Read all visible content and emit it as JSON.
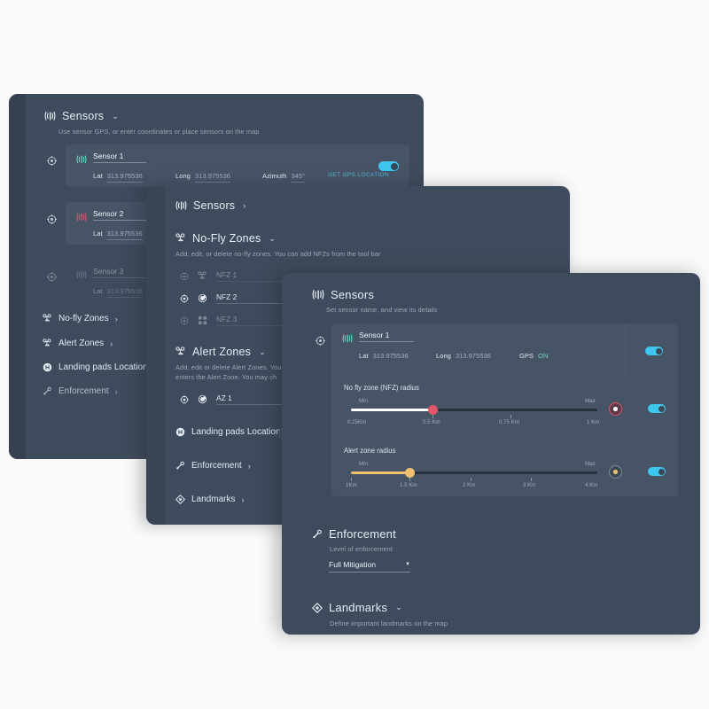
{
  "canvas": {
    "background": "#fafafa"
  },
  "theme": {
    "panel_bg": "#3e4b5c",
    "card_bg": "#475466",
    "accent_cyan": "#3fc6ef",
    "accent_red": "#e05569",
    "accent_amber": "#f0c070",
    "text_primary": "#e8edf2",
    "text_muted": "#9aa7b5"
  },
  "panel_back": {
    "title": "Sensors",
    "chevron": "⌄",
    "subtitle": "Use sensor GPS, or enter coordinates or place sensors on the map",
    "sensors": [
      {
        "name": "Sensor 1",
        "lat_label": "Lat",
        "lat_value": "313.975536",
        "long_label": "Long",
        "long_value": "313.975536",
        "azimuth_label": "Azimuth",
        "azimuth_value": "345°",
        "gps_button": "GET GPS LOCATION",
        "enabled": true,
        "icon": "antenna-icon",
        "icon_color": "#5fe0c0",
        "state": "active"
      },
      {
        "name": "Sensor 2",
        "lat_label": "Lat",
        "lat_value": "313.975536",
        "icon": "antenna-icon",
        "icon_color": "#e05569",
        "state": "selected"
      },
      {
        "name": "Sensor 3",
        "lat_label": "Lat",
        "lat_value": "313.975536",
        "icon": "antenna-icon",
        "icon_color": "#8d9aa8",
        "state": "disabled"
      }
    ],
    "nav": [
      {
        "label": "No-fly Zones",
        "icon": "drone-zone-icon",
        "arrow": "›"
      },
      {
        "label": "Alert Zones",
        "icon": "drone-zone-icon",
        "arrow": "›"
      },
      {
        "label": "Landing pads Location",
        "icon": "helipad-icon",
        "arrow": "›"
      },
      {
        "label": "Enforcement",
        "icon": "enforcement-icon",
        "arrow": "›"
      }
    ]
  },
  "panel_mid": {
    "sensors_link": {
      "label": "Sensors",
      "arrow": "›",
      "icon": "antenna-icon"
    },
    "nfz": {
      "title": "No-Fly Zones",
      "chevron": "⌄",
      "subtitle": "Add, edit, or delete no-fly zones. You can add NFZs from the tool bar",
      "zones": [
        {
          "name": "NFZ 1",
          "icon": "drone-zone-icon",
          "state": "disabled"
        },
        {
          "name": "NFZ 2",
          "icon": "circle-arrow-icon",
          "state": "active"
        },
        {
          "name": "NFZ 3",
          "icon": "grid-zone-icon",
          "state": "disabled"
        }
      ]
    },
    "alert": {
      "title": "Alert Zones",
      "chevron": "⌄",
      "subtitle_line1": "Add, edit or delete Alert Zones. You",
      "subtitle_line2": "enters the Alert Zone. You may ch",
      "zones": [
        {
          "name": "AZ 1",
          "icon": "circle-arrow-icon",
          "state": "active"
        }
      ]
    },
    "nav": [
      {
        "label": "Landing pads Location",
        "icon": "helipad-icon",
        "arrow": "›"
      },
      {
        "label": "Enforcement",
        "icon": "enforcement-icon",
        "arrow": "›"
      },
      {
        "label": "Landmarks",
        "icon": "landmark-icon",
        "arrow": "›"
      }
    ]
  },
  "panel_front": {
    "sensors": {
      "title": "Sensors",
      "subtitle": "Set sensor name, and view its details",
      "sensor": {
        "name": "Sensor 1",
        "lat_label": "Lat",
        "lat_value": "313.975536",
        "long_label": "Long",
        "long_value": "313.975536",
        "gps_label": "GPS",
        "gps_value": "ON",
        "enabled": true
      },
      "nfz_slider": {
        "title": "No fly zone (NFZ) radius",
        "min_label": "Min",
        "max_label": "Max",
        "ticks": [
          "0.25Km",
          "0.5 Km",
          "0.75 Km",
          "1 Km"
        ],
        "value": "0.5 Km",
        "fill_percent": 33,
        "color": "#e05569",
        "enabled": true
      },
      "alert_slider": {
        "title": "Alert zone radius",
        "min_label": "Min",
        "max_label": "Max",
        "ticks": [
          "1Km",
          "1.5 Km",
          "2 Km",
          "3 Km",
          "4 Km"
        ],
        "value": "1.5 Km",
        "fill_percent": 24,
        "color": "#f0c070",
        "enabled": true
      }
    },
    "enforcement": {
      "title": "Enforcement",
      "subtitle": "Level of enforcement",
      "selected": "Full Mitigation",
      "caret": "▼"
    },
    "landmarks": {
      "title": "Landmarks",
      "chevron": "⌄",
      "subtitle": "Define important landmarks on the map"
    }
  }
}
